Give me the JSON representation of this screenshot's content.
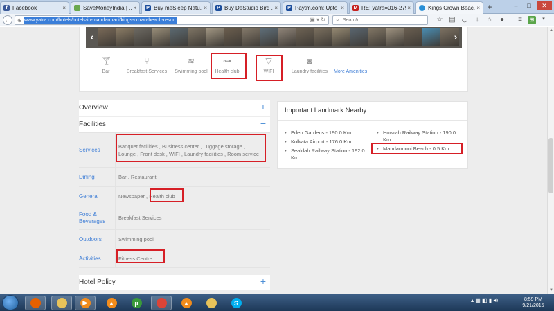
{
  "browser": {
    "tabs": [
      {
        "label": "Facebook",
        "fav_color": "#3b5998",
        "fav_glyph": "f"
      },
      {
        "label": "SaveMoneyIndia | ...",
        "fav_color": "#6aa84f",
        "fav_glyph": ""
      },
      {
        "label": "Buy meSleep Natu...",
        "fav_color": "#1d4e9c",
        "fav_glyph": "P"
      },
      {
        "label": "Buy DeStudio Bird ...",
        "fav_color": "#1d4e9c",
        "fav_glyph": "P"
      },
      {
        "label": "Paytm.com: Upto ...",
        "fav_color": "#1d4e9c",
        "fav_glyph": "P"
      },
      {
        "label": "RE: yatra=016-279-...",
        "fav_color": "#c5221f",
        "fav_glyph": "M"
      },
      {
        "label": "Kings Crown Beac...",
        "fav_color": "#2a8fd6",
        "fav_glyph": "",
        "active": true
      }
    ],
    "close_glyph": "×",
    "new_tab_glyph": "+",
    "url": "www.yatra.com/hotels/hotels-in-mandarmani/kings-crown-beach-resort",
    "search_placeholder": "Search"
  },
  "amenities": {
    "items": [
      "Bar",
      "Breakfast Services",
      "Swimming pool",
      "Health club",
      "WIFI",
      "Laundry facilities"
    ],
    "more_label": "More Amenities",
    "photo_colors": [
      "#7a6a58",
      "#8c7d66",
      "#6d6a63",
      "#9a8f7a",
      "#5c6a72",
      "#7f7565",
      "#a39884",
      "#6b5e4e",
      "#857a6b",
      "#5f6f7a",
      "#91867a",
      "#6e6354",
      "#7b705f",
      "#968a73",
      "#5a6670",
      "#827766",
      "#a09481",
      "#6a5f51",
      "#4a8fb5",
      "#7d7263"
    ]
  },
  "sections": {
    "overview": "Overview",
    "facilities": "Facilities",
    "hotel_policy": "Hotel Policy",
    "expand_glyph": "+",
    "collapse_glyph": "−"
  },
  "facilities": [
    {
      "category": "Services",
      "value": "Banquet facilities , Business center , Luggage storage , Lounge , Front desk , WIFI , Laundry facilities , Room service"
    },
    {
      "category": "Dining",
      "value": "Bar , Restaurant"
    },
    {
      "category": "General",
      "value_prefix": "Newspaper , ",
      "value_highlight": "Health club"
    },
    {
      "category": "Food & Beverages",
      "value": "Breakfast Services"
    },
    {
      "category": "Outdoors",
      "value": "Swimming pool"
    },
    {
      "category": "Activities",
      "value": "Fitness Centre"
    }
  ],
  "landmarks": {
    "title": "Important Landmark Nearby",
    "left": [
      "Eden Gardens - 190.0 Km",
      "Kolkata Airport - 176.0 Km",
      "Sealdah Railway Station - 192.0 Km"
    ],
    "right": [
      "Howrah Railway Station - 190.0 Km",
      "Mandarmoni Beach - 0.5 Km"
    ]
  },
  "taskbar": {
    "apps": [
      {
        "name": "firefox",
        "color": "#e66000",
        "glyph": ""
      },
      {
        "name": "explorer",
        "color": "#e8c35a",
        "glyph": ""
      },
      {
        "name": "media-player",
        "color": "#f28c1c",
        "glyph": "▶"
      },
      {
        "name": "vlc",
        "color": "#f28c1c",
        "glyph": "▲"
      },
      {
        "name": "utorrent",
        "color": "#3a9a3a",
        "glyph": "µ"
      },
      {
        "name": "chrome",
        "color": "#db4437",
        "glyph": ""
      },
      {
        "name": "vlc-2",
        "color": "#f28c1c",
        "glyph": "▲"
      },
      {
        "name": "folder",
        "color": "#e8c35a",
        "glyph": ""
      },
      {
        "name": "skype",
        "color": "#00aff0",
        "glyph": "S"
      }
    ],
    "time": "8:59 PM",
    "date": "9/21/2015"
  }
}
